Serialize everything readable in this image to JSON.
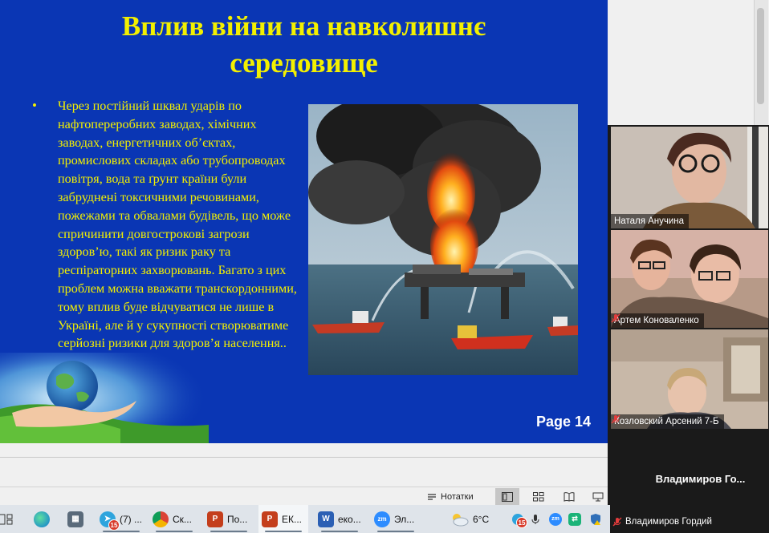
{
  "slide": {
    "title_line1": "Вплив війни на навколишнє",
    "title_line2": "середовище",
    "bullet": "•",
    "body": "Через постійний шквал ударів по нафтопереробних заводах, хімічних заводах, енергетичних об’єктах, промислових складах або трубопроводах повітря, вода та ґрунт країни були забруднені токсичними речовинами, пожежами та обвалами будівель, що може спричинити довгострокові загрози здоров’ю, такі як ризик раку та респіраторних захворювань. Багато з цих проблем можна вважати транскордонними, тому вплив буде відчуватися не лише в Україні, але й у сукупності створюватиме серйозні ризики для здоров’я населення..",
    "page": "Page 14"
  },
  "statusbar": {
    "notes_label": "Нотатки"
  },
  "participants": [
    {
      "name": "Наталя Анучина",
      "muted": false,
      "speaking": true
    },
    {
      "name": "Артем Коноваленко",
      "muted": true,
      "speaking": false
    },
    {
      "name": "Козловский Арсений 7-Б",
      "muted": true,
      "speaking": false
    }
  ],
  "video_off_name": "Владимиров  Го...",
  "video_off_full_name": "Владимиров Гордий",
  "taskbar": {
    "items": [
      {
        "label": "(7) ...",
        "icon": "telegram-icon",
        "badge": "15"
      },
      {
        "label": "Ск...",
        "icon": "chrome-icon"
      },
      {
        "label": "По...",
        "icon": "powerpoint-icon"
      },
      {
        "label": "ЕК...",
        "icon": "powerpoint-icon"
      },
      {
        "label": "еко...",
        "icon": "word-icon"
      },
      {
        "label": "Эл...",
        "icon": "zoom-icon"
      }
    ],
    "weather": "6°C",
    "tray_badge": "15"
  },
  "colors": {
    "slide_bg": "#0a36b4",
    "slide_text": "#f3f000",
    "speaking_outline": "#3fd06a",
    "muted_mic": "#e23c3c"
  }
}
